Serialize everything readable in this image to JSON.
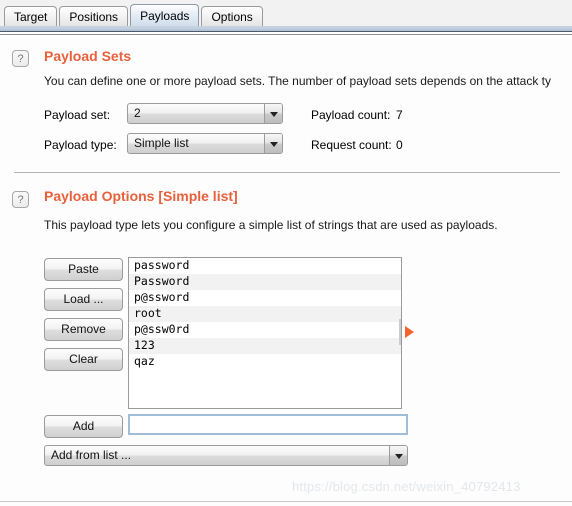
{
  "window": {
    "watermark": "https://blog.csdn.net/weixin_40792413"
  },
  "tabs": [
    {
      "label": "Target",
      "selected": false
    },
    {
      "label": "Positions",
      "selected": false
    },
    {
      "label": "Payloads",
      "selected": true
    },
    {
      "label": "Options",
      "selected": false
    }
  ],
  "payload_sets": {
    "help_icon": "question-mark-icon",
    "title": "Payload Sets",
    "description": "You can define one or more payload sets. The number of payload sets depends on the attack ty",
    "payload_set_label": "Payload set:",
    "payload_set_value": "2",
    "payload_type_label": "Payload type:",
    "payload_type_value": "Simple list",
    "payload_count_label": "Payload count:",
    "payload_count_value": "7",
    "request_count_label": "Request count:",
    "request_count_value": "0"
  },
  "payload_options": {
    "help_icon": "question-mark-icon",
    "title": "Payload Options [Simple list]",
    "description": "This payload type lets you configure a simple list of strings that are used as payloads.",
    "buttons": [
      {
        "label": "Paste"
      },
      {
        "label": "Load ..."
      },
      {
        "label": "Remove"
      },
      {
        "label": "Clear"
      }
    ],
    "list_items": [
      "password",
      "Password",
      "p@ssword",
      "root",
      "p@ssw0rd",
      "123",
      "qaz"
    ],
    "add_button_label": "Add",
    "add_input_value": "",
    "add_input_placeholder": "",
    "add_from_list_label": "Add from list ...",
    "expander_icon": "triangle-right-icon"
  },
  "colors": {
    "accent": "#e8603c",
    "expander": "#f4622d",
    "tab_selected": "#cfdcea"
  }
}
